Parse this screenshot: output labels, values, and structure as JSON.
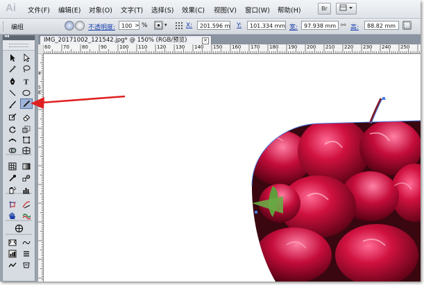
{
  "app": {
    "logo": "Ai"
  },
  "menubar": {
    "items": [
      "文件(F)",
      "编辑(E)",
      "对象(O)",
      "文字(T)",
      "选择(S)",
      "效果(C)",
      "视图(V)",
      "窗口(W)",
      "帮助(H)"
    ],
    "bridge_label": "Br"
  },
  "controlbar": {
    "selection_label": "编组",
    "opacity_label": "不透明度:",
    "opacity_value": "100",
    "percent_sign": "%",
    "x_label": "X:",
    "x_value": "201.596 mm",
    "y_label": "Y:",
    "y_value": "101.334 mm",
    "width_label": "宽:",
    "width_value": "97.938 mm",
    "height_label": "高:",
    "height_value": "88.82 mm"
  },
  "document": {
    "tab_title": "IMG_20171002_121542.jpg* @ 150% (RGB/预览)",
    "close_symbol": "×"
  },
  "ruler": {
    "h_labels": [
      "60",
      "70",
      "80",
      "90",
      "100",
      "110",
      "120",
      "130",
      "140",
      "150",
      "160",
      "170",
      "180",
      "190",
      "200",
      "210",
      "220",
      "230",
      "240",
      "250"
    ],
    "v_labels": [
      "4",
      "5",
      "6",
      "7"
    ]
  },
  "toolbox": {
    "active_tool": "pencil-tool"
  },
  "colors": {
    "annotation_arrow": "#e02020",
    "active_tool_bg": "#9fb4d8",
    "menubar_bg": "#e6e9ee",
    "workspace_bg": "#9aa2ad"
  }
}
